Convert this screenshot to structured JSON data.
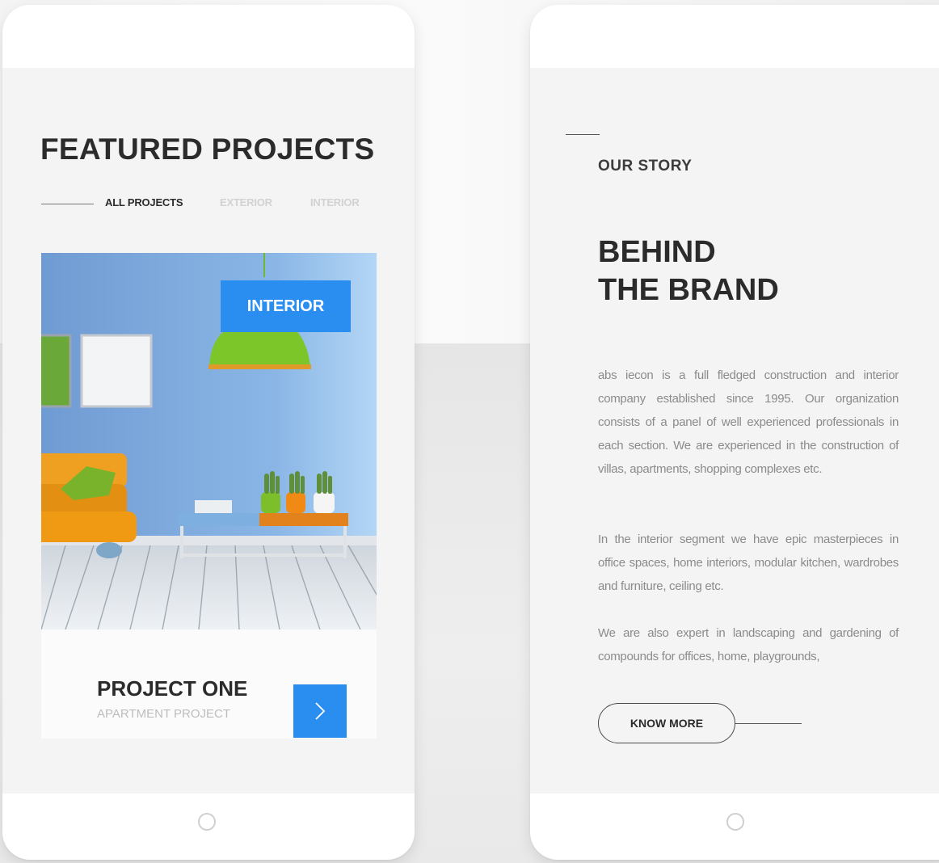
{
  "featured": {
    "title": "FEATURED PROJECTS",
    "tabs": [
      {
        "label": "ALL PROJECTS",
        "active": true
      },
      {
        "label": "EXTERIOR",
        "active": false
      },
      {
        "label": "INTERIOR",
        "active": false
      }
    ],
    "card": {
      "category": "INTERIOR",
      "project_title": "PROJECT ONE",
      "project_subtitle": "APARTMENT PROJECT",
      "next_icon": "chevron-right-icon"
    }
  },
  "story": {
    "eyebrow": "OUR STORY",
    "title_line1": "BEHIND",
    "title_line2": "THE BRAND",
    "paragraphs": [
      "abs iecon is a full fledged construction and interior company established since 1995. Our organization consists of a panel of well experienced professionals in each section. We are experienced in the construction of villas, apartments, shopping complexes etc.",
      "In the interior segment we have epic masterpieces in office spaces, home interiors, modular kitchen, wardrobes and furniture, ceiling etc.",
      "We are also expert in landscaping and gardening of compounds for offices, home, playgrounds,"
    ],
    "cta": "KNOW MORE"
  },
  "colors": {
    "accent": "#2a8ef0",
    "heading": "#2b2b2b",
    "body_text": "#8b8b8b",
    "tab_inactive": "#d2d2d2"
  }
}
